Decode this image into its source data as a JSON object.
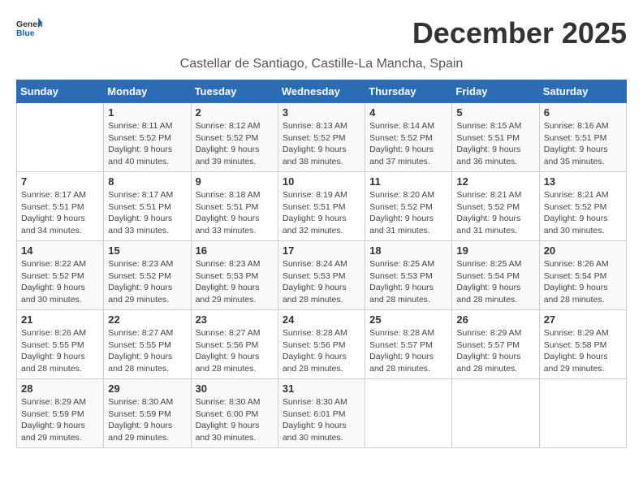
{
  "header": {
    "logo_line1": "General",
    "logo_line2": "Blue",
    "month": "December 2025",
    "location": "Castellar de Santiago, Castille-La Mancha, Spain"
  },
  "weekdays": [
    "Sunday",
    "Monday",
    "Tuesday",
    "Wednesday",
    "Thursday",
    "Friday",
    "Saturday"
  ],
  "weeks": [
    [
      {
        "day": "",
        "info": ""
      },
      {
        "day": "1",
        "info": "Sunrise: 8:11 AM\nSunset: 5:52 PM\nDaylight: 9 hours\nand 40 minutes."
      },
      {
        "day": "2",
        "info": "Sunrise: 8:12 AM\nSunset: 5:52 PM\nDaylight: 9 hours\nand 39 minutes."
      },
      {
        "day": "3",
        "info": "Sunrise: 8:13 AM\nSunset: 5:52 PM\nDaylight: 9 hours\nand 38 minutes."
      },
      {
        "day": "4",
        "info": "Sunrise: 8:14 AM\nSunset: 5:52 PM\nDaylight: 9 hours\nand 37 minutes."
      },
      {
        "day": "5",
        "info": "Sunrise: 8:15 AM\nSunset: 5:51 PM\nDaylight: 9 hours\nand 36 minutes."
      },
      {
        "day": "6",
        "info": "Sunrise: 8:16 AM\nSunset: 5:51 PM\nDaylight: 9 hours\nand 35 minutes."
      }
    ],
    [
      {
        "day": "7",
        "info": "Sunrise: 8:17 AM\nSunset: 5:51 PM\nDaylight: 9 hours\nand 34 minutes."
      },
      {
        "day": "8",
        "info": "Sunrise: 8:17 AM\nSunset: 5:51 PM\nDaylight: 9 hours\nand 33 minutes."
      },
      {
        "day": "9",
        "info": "Sunrise: 8:18 AM\nSunset: 5:51 PM\nDaylight: 9 hours\nand 33 minutes."
      },
      {
        "day": "10",
        "info": "Sunrise: 8:19 AM\nSunset: 5:51 PM\nDaylight: 9 hours\nand 32 minutes."
      },
      {
        "day": "11",
        "info": "Sunrise: 8:20 AM\nSunset: 5:52 PM\nDaylight: 9 hours\nand 31 minutes."
      },
      {
        "day": "12",
        "info": "Sunrise: 8:21 AM\nSunset: 5:52 PM\nDaylight: 9 hours\nand 31 minutes."
      },
      {
        "day": "13",
        "info": "Sunrise: 8:21 AM\nSunset: 5:52 PM\nDaylight: 9 hours\nand 30 minutes."
      }
    ],
    [
      {
        "day": "14",
        "info": "Sunrise: 8:22 AM\nSunset: 5:52 PM\nDaylight: 9 hours\nand 30 minutes."
      },
      {
        "day": "15",
        "info": "Sunrise: 8:23 AM\nSunset: 5:52 PM\nDaylight: 9 hours\nand 29 minutes."
      },
      {
        "day": "16",
        "info": "Sunrise: 8:23 AM\nSunset: 5:53 PM\nDaylight: 9 hours\nand 29 minutes."
      },
      {
        "day": "17",
        "info": "Sunrise: 8:24 AM\nSunset: 5:53 PM\nDaylight: 9 hours\nand 28 minutes."
      },
      {
        "day": "18",
        "info": "Sunrise: 8:25 AM\nSunset: 5:53 PM\nDaylight: 9 hours\nand 28 minutes."
      },
      {
        "day": "19",
        "info": "Sunrise: 8:25 AM\nSunset: 5:54 PM\nDaylight: 9 hours\nand 28 minutes."
      },
      {
        "day": "20",
        "info": "Sunrise: 8:26 AM\nSunset: 5:54 PM\nDaylight: 9 hours\nand 28 minutes."
      }
    ],
    [
      {
        "day": "21",
        "info": "Sunrise: 8:26 AM\nSunset: 5:55 PM\nDaylight: 9 hours\nand 28 minutes."
      },
      {
        "day": "22",
        "info": "Sunrise: 8:27 AM\nSunset: 5:55 PM\nDaylight: 9 hours\nand 28 minutes."
      },
      {
        "day": "23",
        "info": "Sunrise: 8:27 AM\nSunset: 5:56 PM\nDaylight: 9 hours\nand 28 minutes."
      },
      {
        "day": "24",
        "info": "Sunrise: 8:28 AM\nSunset: 5:56 PM\nDaylight: 9 hours\nand 28 minutes."
      },
      {
        "day": "25",
        "info": "Sunrise: 8:28 AM\nSunset: 5:57 PM\nDaylight: 9 hours\nand 28 minutes."
      },
      {
        "day": "26",
        "info": "Sunrise: 8:29 AM\nSunset: 5:57 PM\nDaylight: 9 hours\nand 28 minutes."
      },
      {
        "day": "27",
        "info": "Sunrise: 8:29 AM\nSunset: 5:58 PM\nDaylight: 9 hours\nand 29 minutes."
      }
    ],
    [
      {
        "day": "28",
        "info": "Sunrise: 8:29 AM\nSunset: 5:59 PM\nDaylight: 9 hours\nand 29 minutes."
      },
      {
        "day": "29",
        "info": "Sunrise: 8:30 AM\nSunset: 5:59 PM\nDaylight: 9 hours\nand 29 minutes."
      },
      {
        "day": "30",
        "info": "Sunrise: 8:30 AM\nSunset: 6:00 PM\nDaylight: 9 hours\nand 30 minutes."
      },
      {
        "day": "31",
        "info": "Sunrise: 8:30 AM\nSunset: 6:01 PM\nDaylight: 9 hours\nand 30 minutes."
      },
      {
        "day": "",
        "info": ""
      },
      {
        "day": "",
        "info": ""
      },
      {
        "day": "",
        "info": ""
      }
    ]
  ]
}
